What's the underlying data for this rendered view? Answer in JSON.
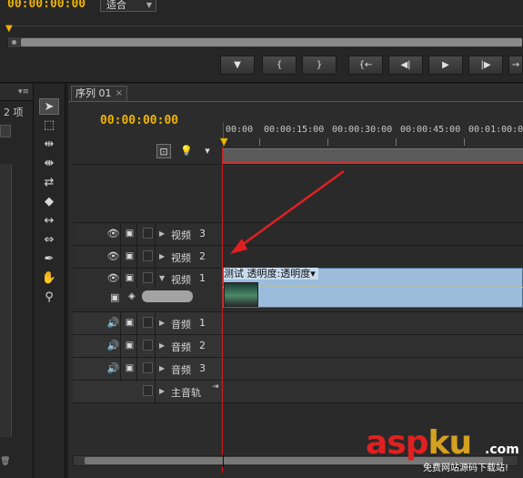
{
  "source_monitor": {
    "timecode": "00:00:00:00",
    "zoom_select": "适合",
    "transport_buttons": [
      "▼",
      "{",
      "}",
      "{←",
      "◀|",
      "▶",
      "|▶",
      "→"
    ]
  },
  "project_panel": {
    "item_count": "2 项"
  },
  "tools": [
    "selection-tool",
    "track-select-tool",
    "ripple-edit-tool",
    "rolling-edit-tool",
    "rate-stretch-tool",
    "razor-tool",
    "slip-tool",
    "slide-tool",
    "pen-tool",
    "hand-tool",
    "zoom-tool"
  ],
  "timeline": {
    "tab_label": "序列 01",
    "timecode": "00:00:00:00",
    "ruler_ticks": [
      "00:00",
      "00:00:15:00",
      "00:00:30:00",
      "00:00:45:00",
      "00:01:00:00"
    ],
    "video_tracks": [
      {
        "name": "视频",
        "num": "3"
      },
      {
        "name": "视频",
        "num": "2"
      },
      {
        "name": "视频",
        "num": "1"
      }
    ],
    "audio_tracks": [
      {
        "name": "音频",
        "num": "1"
      },
      {
        "name": "音频",
        "num": "2"
      },
      {
        "name": "音频",
        "num": "3"
      }
    ],
    "master_track": "主音轨",
    "clip": {
      "label": "测试 透明度:透明度▾",
      "color": "#9cbcdc"
    }
  },
  "watermark": {
    "brand_a": "asp",
    "brand_b": "ku",
    "domain": ".com",
    "subtitle": "免费网站源码下载站!"
  },
  "colors": {
    "timecode": "#f0b400",
    "playhead": "#d02020",
    "annotation_arrow": "#e02020"
  }
}
